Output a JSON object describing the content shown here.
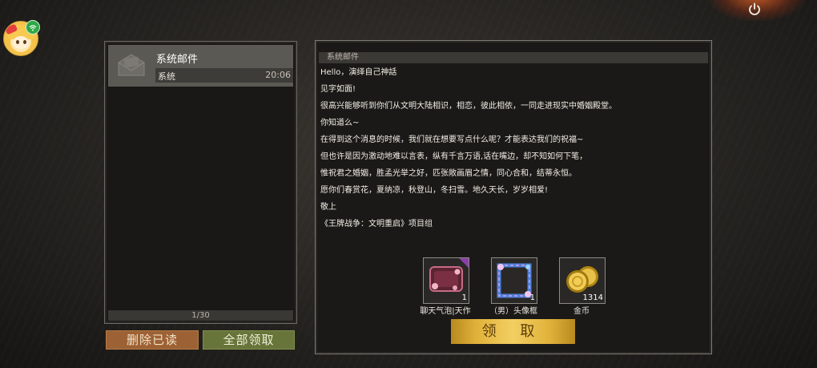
{
  "mail_list": {
    "items": [
      {
        "title": "系统邮件",
        "sender": "系统",
        "time": "20:06",
        "icon": "envelope-icon"
      }
    ],
    "pager": "1/30"
  },
  "buttons": {
    "delete_read": "删除已读",
    "collect_all": "全部领取",
    "collect": "领 取"
  },
  "mail_detail": {
    "header": "系统邮件",
    "lines": [
      "Hello，演绎自己神話",
      "见字如面!",
      "很高兴能够听到你们从文明大陆相识，相恋，彼此相依，一同走进现实中婚姻殿堂。",
      "你知道么~",
      "在得到这个消息的时候，我们就在想要写点什么呢？才能表达我们的祝福~",
      "但也许是因为激动地难以言表，纵有千言万语,话在嘴边，却不知如何下笔，",
      "惟祝君之婚姻，胜孟光举之好，匹张敞画眉之情，同心合和，结蒂永恒。",
      "愿你们春赏花，夏纳凉，秋登山，冬扫雪。地久天长，岁岁相爱!",
      "敬上",
      "《王牌战争：文明重启》项目组"
    ],
    "rewards": [
      {
        "name": "聊天气泡|天作",
        "qty": "1",
        "icon": "chat-bubble-icon"
      },
      {
        "name": "（男）头像框",
        "qty": "1",
        "icon": "avatar-frame-icon"
      },
      {
        "name": "金币",
        "qty": "1314",
        "icon": "gold-coin-icon"
      }
    ]
  },
  "header": {
    "avatar": "player-avatar",
    "status_icon": "wifi-icon",
    "power_icon": "power-icon"
  },
  "colors": {
    "accent_gold": "#e0b13a",
    "delete_btn": "#9c6134",
    "collect_all_btn": "#67743a"
  }
}
